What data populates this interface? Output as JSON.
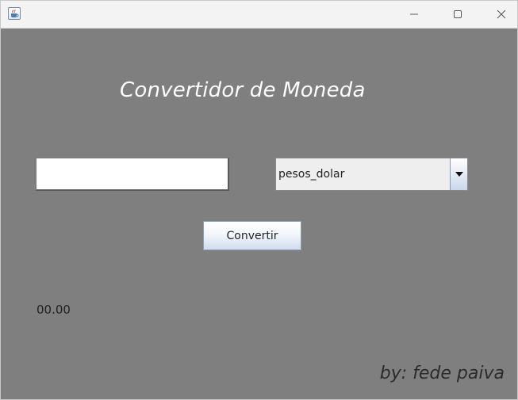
{
  "window": {
    "app_icon": "java-cup-icon",
    "controls": [
      "minimize-icon",
      "maximize-icon",
      "close-icon"
    ]
  },
  "main": {
    "title": "Convertidor de Moneda",
    "amount_input": {
      "value": "",
      "placeholder": ""
    },
    "conversion_select": {
      "selected": "pesos_dolar"
    },
    "convert_label": "Convertir",
    "result": "00.00",
    "signature": "by: fede paiva"
  },
  "colors": {
    "background": "#7f7f7f",
    "title_text": "#ffffff",
    "titlebar": "#f3f3f3"
  }
}
